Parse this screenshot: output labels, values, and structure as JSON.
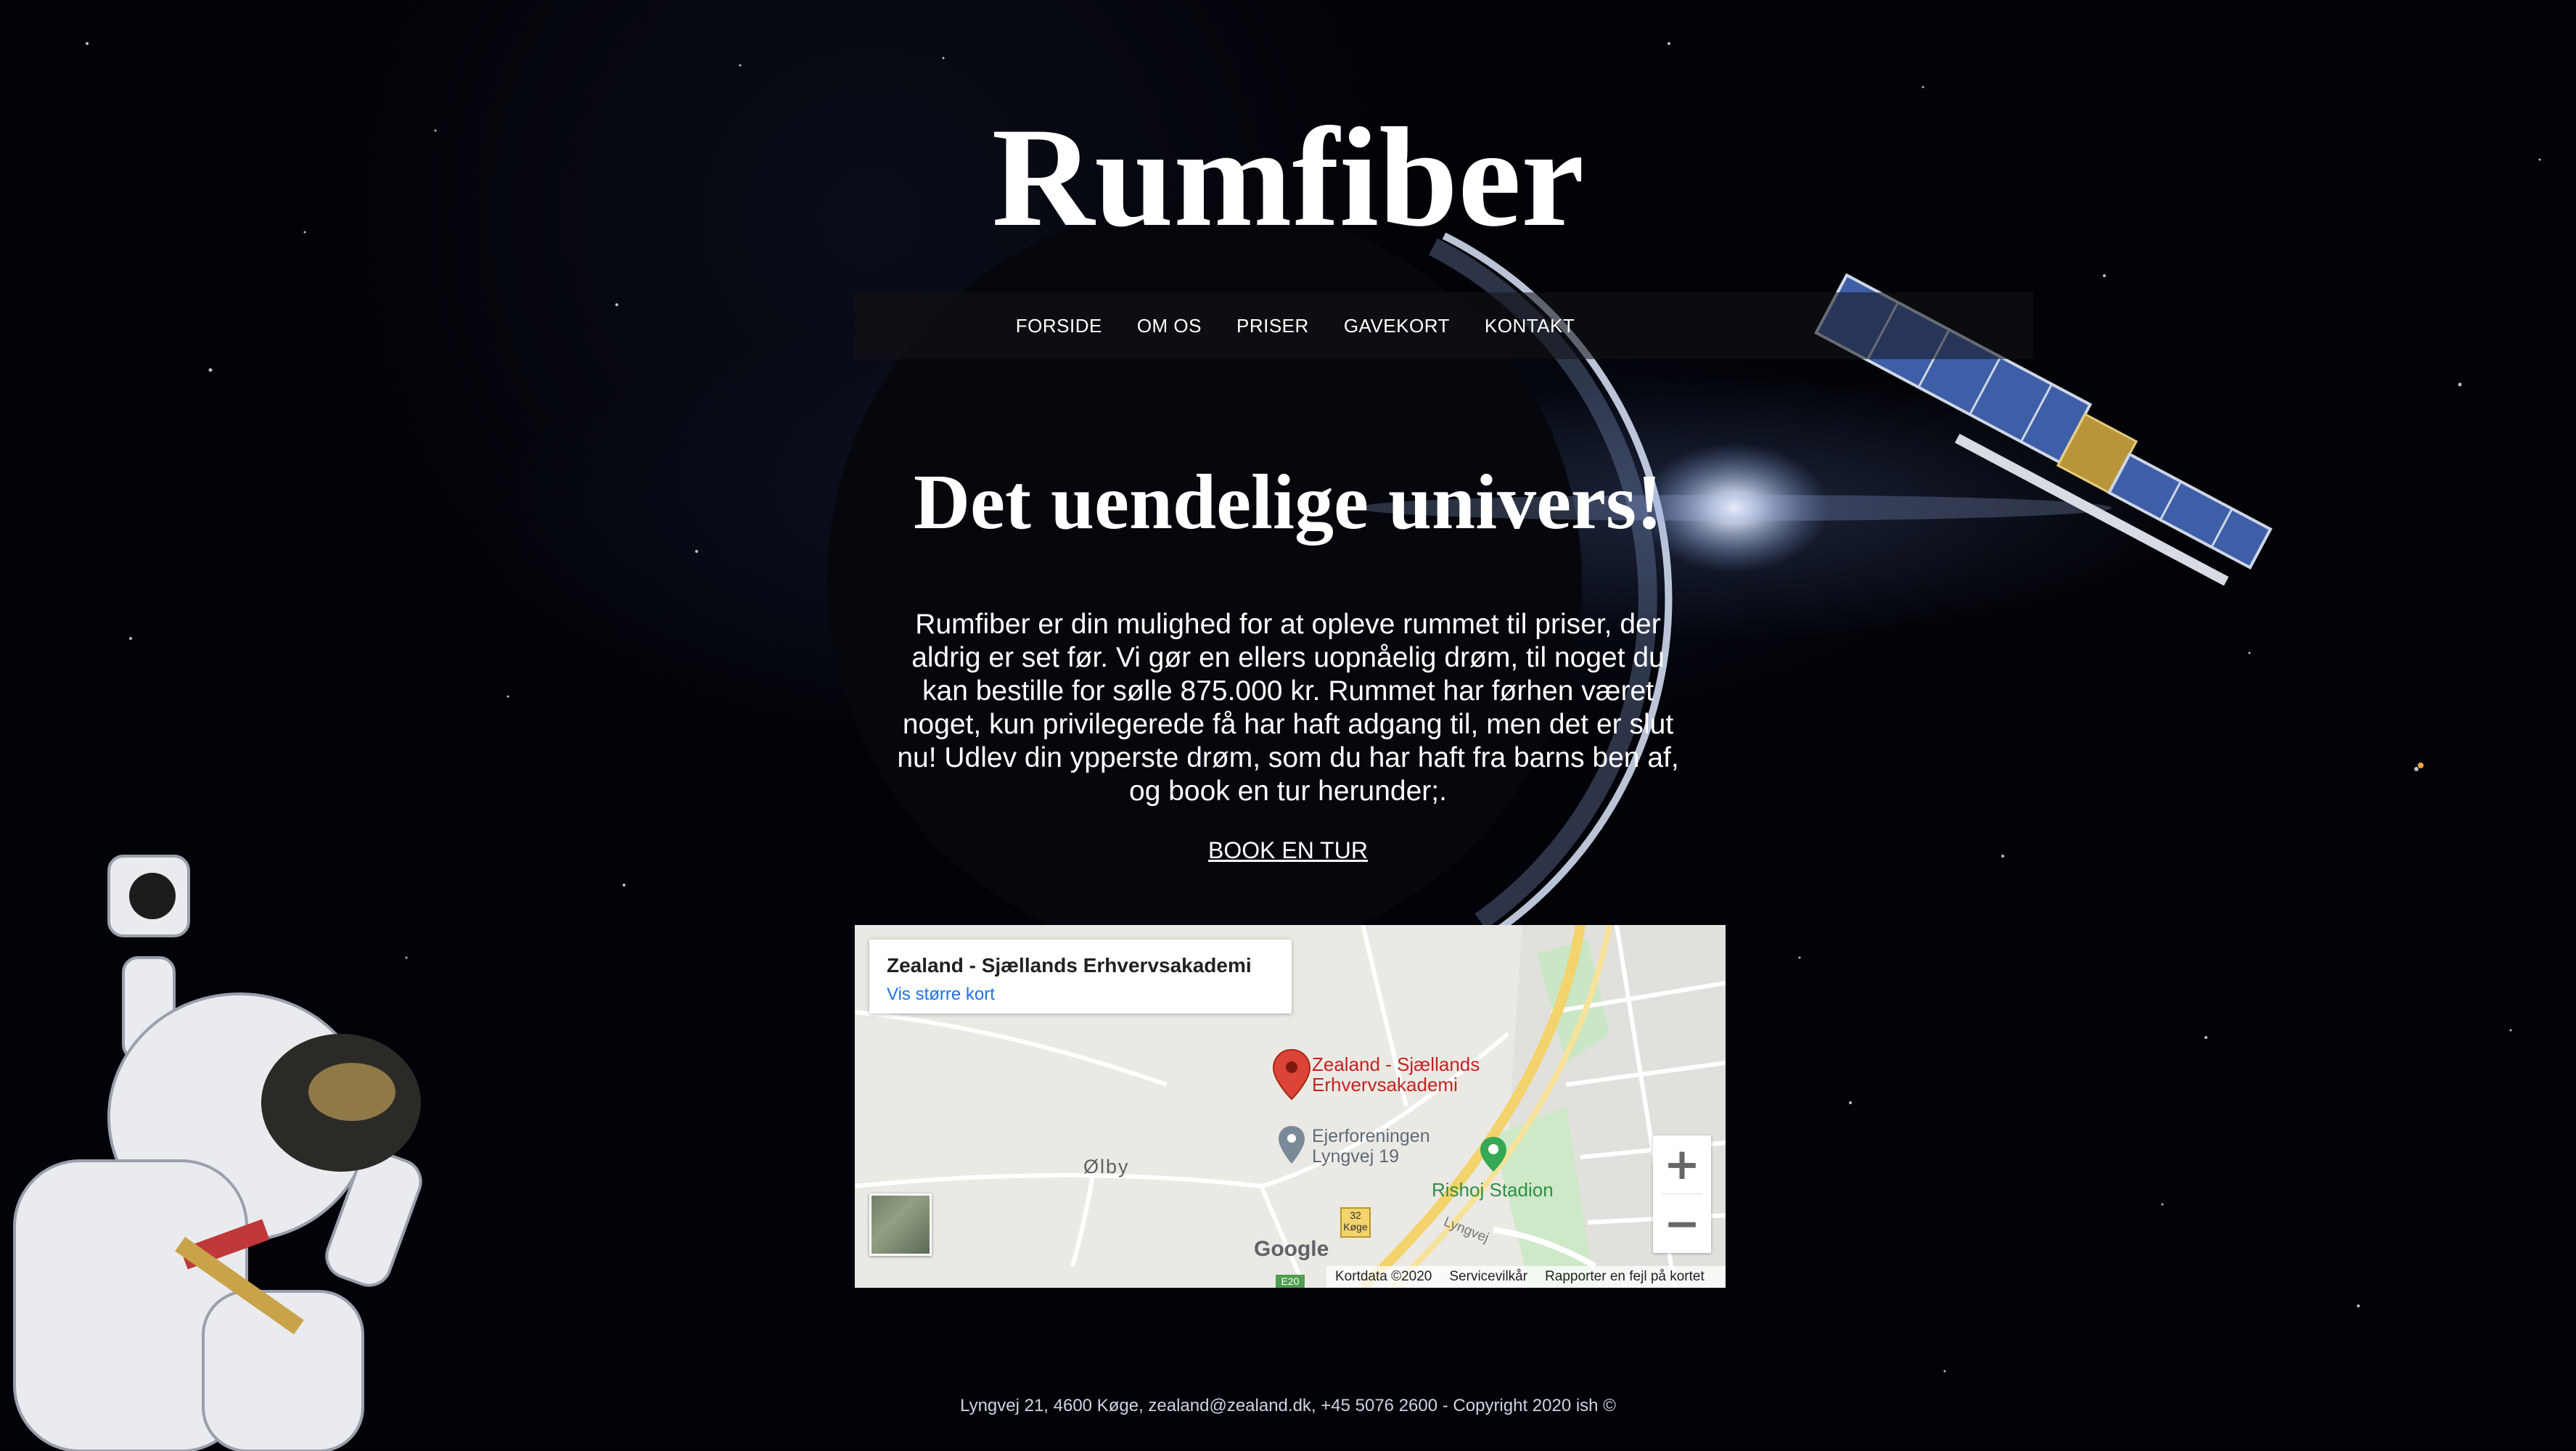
{
  "site": {
    "title": "Rumfiber"
  },
  "nav": {
    "items": [
      {
        "label": "FORSIDE"
      },
      {
        "label": "OM OS"
      },
      {
        "label": "PRISER"
      },
      {
        "label": "GAVEKORT"
      },
      {
        "label": "KONTAKT"
      }
    ]
  },
  "hero": {
    "headline": "Det uendelige univers!",
    "intro": "Rumfiber er din mulighed for at opleve rummet til priser, der aldrig er set før. Vi gør en ellers uopnåelig drøm, til noget du kan bestille for sølle 875.000 kr. Rummet har førhen været noget, kun privilegerede få har haft adgang til, men det er slut nu! Udlev din ypperste drøm, som du har haft fra barns ben af, og book en tur herunder;.",
    "book_label": "BOOK EN TUR"
  },
  "map": {
    "card_title": "Zealand - Sjællands Erhvervsakademi",
    "card_link": "Vis større kort",
    "pin_label_line1": "Zealand - Sjællands",
    "pin_label_line2": "Erhvervsakademi",
    "poi1_line1": "Ejerforeningen",
    "poi1_line2": "Lyngvej 19",
    "poi2": "Rishoj Stadion",
    "place": "Ølby",
    "road_label": "Lyngvej",
    "road_shield_num": "32",
    "road_shield_town": "Køge",
    "road_shield_e": "E20",
    "google": "Google",
    "zoom_in": "+",
    "zoom_out": "−",
    "footer": {
      "data": "Kortdata ©2020",
      "terms": "Servicevilkår",
      "report": "Rapporter en fejl på kortet"
    }
  },
  "footer": {
    "text": "Lyngvej 21, 4600 Køge, zealand@zealand.dk, +45 5076 2600 - Copyright 2020 ish ©"
  },
  "colors": {
    "background": "#000000",
    "nav_bar": "#141416",
    "map_link": "#1a73e8",
    "map_pin": "#db4437"
  }
}
